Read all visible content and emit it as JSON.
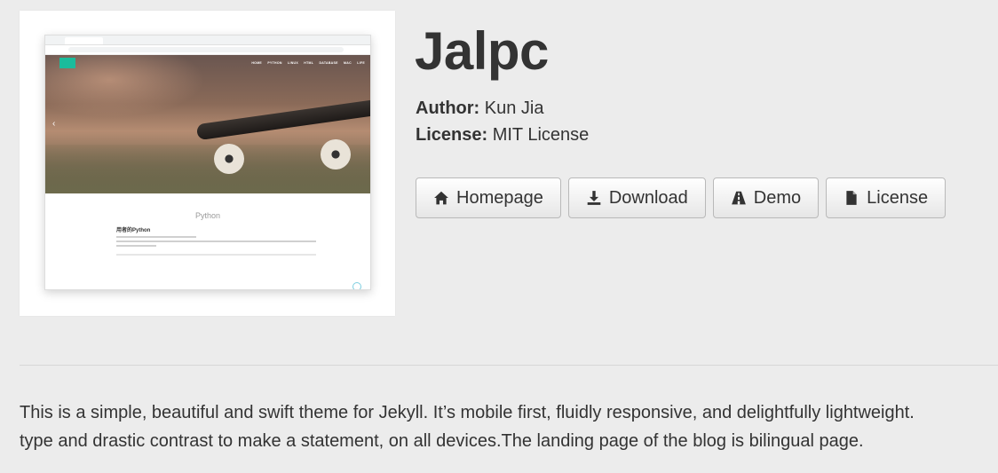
{
  "theme": {
    "title": "Jalpc",
    "author_label": "Author:",
    "author": "Kun Jia",
    "license_label": "License:",
    "license": "MIT License"
  },
  "buttons": [
    {
      "label": "Homepage",
      "icon": "home-icon"
    },
    {
      "label": "Download",
      "icon": "download-icon"
    },
    {
      "label": "Demo",
      "icon": "road-icon"
    },
    {
      "label": "License",
      "icon": "file-icon"
    }
  ],
  "preview": {
    "nav_items": [
      "HOME",
      "PYTHON",
      "LINUX",
      "HTML",
      "DATABASE",
      "MAC",
      "LIFE"
    ],
    "section_title": "Python",
    "post_title": "用者的Python"
  },
  "description": {
    "line1": "This is a simple, beautiful and swift theme for Jekyll. It’s mobile first, fluidly responsive, and delightfully lightweight.",
    "line2": "type and drastic contrast to make a statement, on all devices.The landing page of the blog is bilingual page."
  },
  "colors": {
    "background": "#ececec",
    "text": "#333333",
    "preview_accent": "#1abc9c"
  }
}
